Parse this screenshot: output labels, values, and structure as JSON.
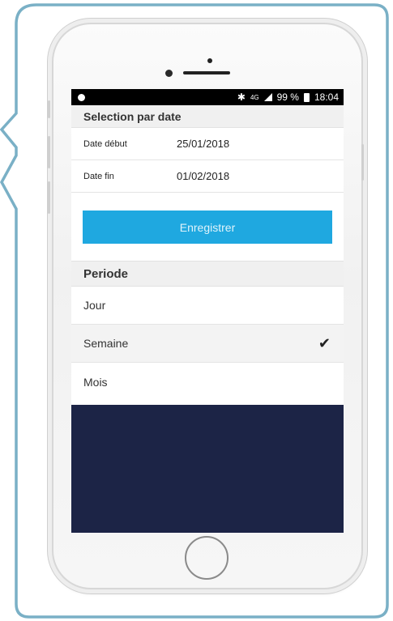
{
  "colors": {
    "frame_border": "#7ab0c6",
    "accent": "#1fa8e0",
    "dark_panel": "#1c2446"
  },
  "status_bar": {
    "network": "4G",
    "battery": "99 %",
    "time": "18:04",
    "icons": [
      "circle-icon",
      "bluetooth-icon",
      "signal-icon",
      "battery-icon"
    ]
  },
  "date_section": {
    "title": "Selection par date",
    "start_label": "Date début",
    "start_value": "25/01/2018",
    "end_label": "Date fin",
    "end_value": "01/02/2018",
    "save_label": "Enregistrer"
  },
  "period_section": {
    "title": "Periode",
    "items": [
      {
        "label": "Jour",
        "selected": false
      },
      {
        "label": "Semaine",
        "selected": true
      },
      {
        "label": "Mois",
        "selected": false
      }
    ],
    "check_icon": "checkmark-icon"
  }
}
